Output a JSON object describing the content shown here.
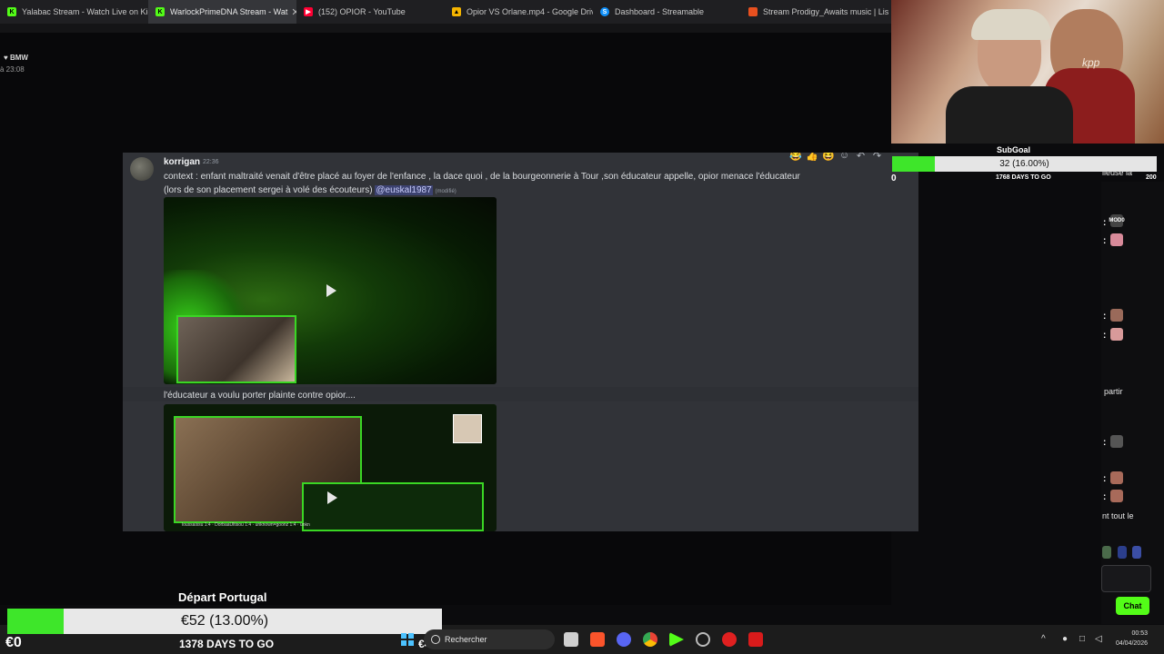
{
  "browser": {
    "tabs": [
      {
        "title": "Yalabac Stream - Watch Live on Kick",
        "favicon": "kick-icon",
        "color": "#53fc18"
      },
      {
        "title": "WarlockPrimeDNA Stream - Wat",
        "favicon": "kick-icon",
        "color": "#53fc18"
      },
      {
        "title": "(152) OPIOR - YouTube",
        "favicon": "youtube-icon",
        "color": "#ff0033"
      },
      {
        "title": "Opior VS Orlane.mp4 - Google Drive",
        "favicon": "drive-icon",
        "color": "#f4b400"
      },
      {
        "title": "Dashboard - Streamable",
        "favicon": "streamable-icon",
        "color": "#0f90fa"
      },
      {
        "title": "Stream Prodigy_Awaits music | Lis",
        "favicon": "stream-icon",
        "color": "#e8501f"
      }
    ]
  },
  "background": {
    "server_tag": "BMW",
    "server_time": "à 23:08"
  },
  "message": {
    "author": "korrigan",
    "timestamp": "22:36",
    "text": "context : enfant maltraité venait d'être placé au foyer de l'enfance , la dace quoi , de la bourgeonnerie à Tour ,son éducateur appelle, opior menace l'éducateur (lors de son placement sergei à volé des écouteurs)",
    "mention": "@euskal1987",
    "edited": "(modifié)",
    "followup": "l'éducateur a voulu porter plainte contre opior....",
    "video2_caption": "loussaissu 1:4 · DorbaaUltisou 1:4 · unknown=goonz 1:4 · unkn"
  },
  "subgoal": {
    "title": "SubGoal",
    "progress_label": "32 (16.00%)",
    "progress": 0.16,
    "start": "0",
    "days": "1768 DAYS TO GO",
    "end": "200"
  },
  "depart_goal": {
    "title": "Départ Portugal",
    "progress_label": "€52 (13.00%)",
    "progress": 0.13,
    "start": "€0",
    "days": "1378 DAYS TO GO",
    "end": "€400"
  },
  "chat": {
    "partial_top": "lleuse la",
    "badge_text": "MOD0",
    "partial_mid": "partir",
    "partial_bottom": "nt tout le",
    "button": "Chat"
  },
  "taskbar": {
    "search_placeholder": "Rechercher",
    "time": "00:53",
    "date": "04/04/2026"
  },
  "colors": {
    "accent_green": "#53fc18",
    "goal_green": "#3ee62a",
    "discord_bg": "#313338"
  }
}
